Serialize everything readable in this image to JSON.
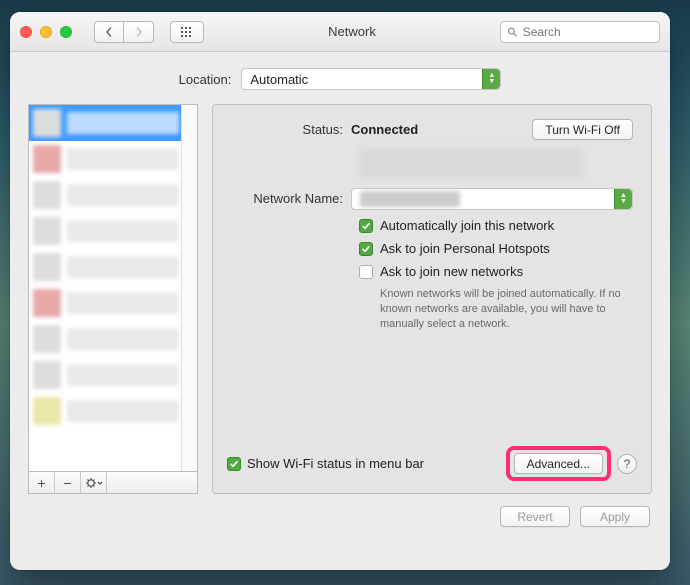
{
  "window": {
    "title": "Network"
  },
  "toolbar": {
    "search_placeholder": "Search"
  },
  "location": {
    "label": "Location:",
    "value": "Automatic"
  },
  "status": {
    "label": "Status:",
    "value": "Connected",
    "wifi_toggle": "Turn Wi-Fi Off"
  },
  "network_name": {
    "label": "Network Name:"
  },
  "options": {
    "auto_join": {
      "label": "Automatically join this network",
      "checked": true
    },
    "personal_hotspots": {
      "label": "Ask to join Personal Hotspots",
      "checked": true
    },
    "ask_new": {
      "label": "Ask to join new networks",
      "checked": false,
      "note": "Known networks will be joined automatically. If no known networks are available, you will have to manually select a network."
    }
  },
  "footer": {
    "show_in_menu": {
      "label": "Show Wi-Fi status in menu bar",
      "checked": true
    },
    "advanced": "Advanced...",
    "help": "?"
  },
  "buttons": {
    "revert": "Revert",
    "apply": "Apply"
  },
  "sidebar": {
    "tool_add": "+",
    "tool_remove": "−",
    "tool_actions": "✻▾"
  }
}
